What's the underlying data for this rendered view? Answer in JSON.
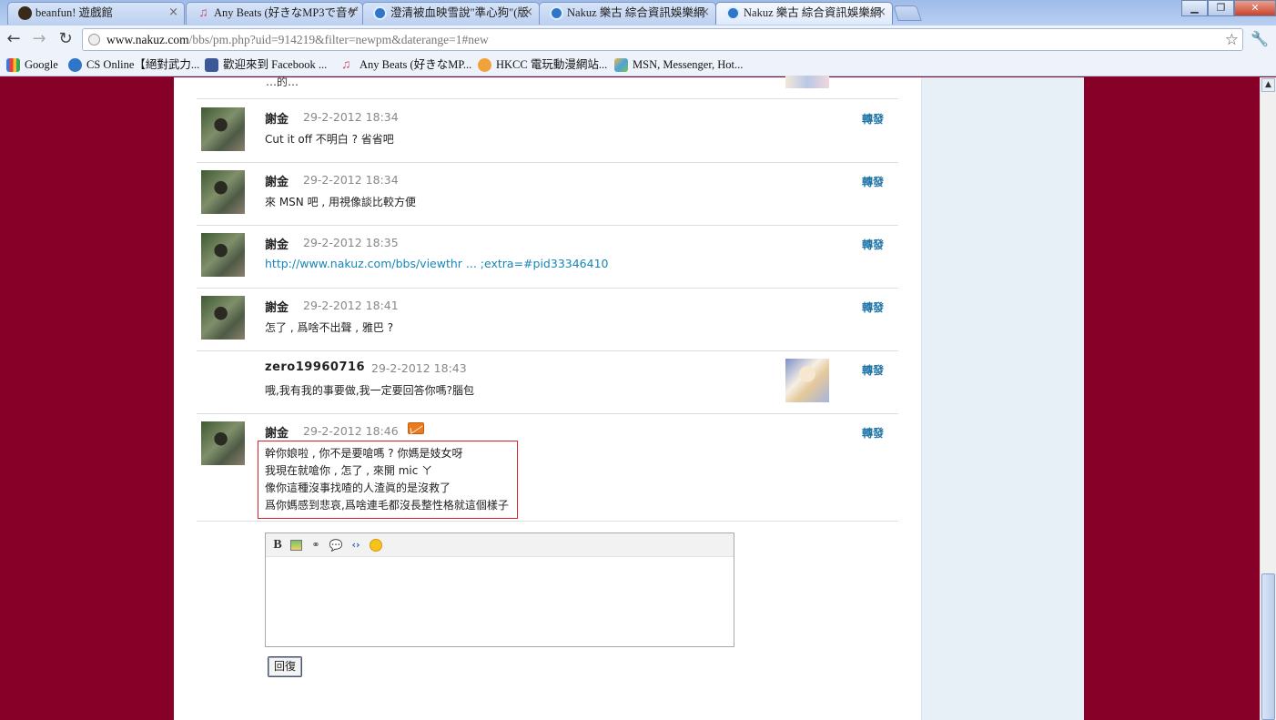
{
  "browser": {
    "tabs": [
      {
        "title": "beanfun! 遊戲館",
        "icon": "beanfun-icon"
      },
      {
        "title": "Any Beats (好きなMP3で音ゲ",
        "icon": "music-note-icon"
      },
      {
        "title": "澄清被血映雪說\"準心狗\"(版",
        "icon": "nakuz-icon"
      },
      {
        "title": "Nakuz 樂古 綜合資訊娛樂網",
        "icon": "nakuz-icon"
      },
      {
        "title": "Nakuz 樂古 綜合資訊娛樂網",
        "icon": "nakuz-icon"
      }
    ],
    "tab_close": "×",
    "url_host": "www.nakuz.com",
    "url_path": "/bbs/pm.php?uid=914219&filter=newpm&daterange=1#new",
    "bookmarks": [
      {
        "label": "Google",
        "icon": "google-icon"
      },
      {
        "label": "CS Online【絕對武力...",
        "icon": "nakuz-icon"
      },
      {
        "label": "歡迎來到 Facebook ...",
        "icon": "facebook-icon"
      },
      {
        "label": "Any Beats (好きなMP...",
        "icon": "music-note-icon"
      },
      {
        "label": "HKCC 電玩動漫網站...",
        "icon": "hkcc-icon"
      },
      {
        "label": "MSN, Messenger, Hot...",
        "icon": "msn-icon"
      }
    ],
    "colors": {
      "page_background": "#870028",
      "link": "#1786b8",
      "highlight_border": "#d8232a"
    }
  },
  "clipped_top_text": "…的…",
  "forward_label": "轉發",
  "messages": [
    {
      "author": "謝金",
      "date": "29-2-2012 18:34",
      "body": "Cut it off 不明白 ? 省省吧"
    },
    {
      "author": "謝金",
      "date": "29-2-2012 18:34",
      "body": "來 MSN 吧 , 用視像談比較方便"
    },
    {
      "author": "謝金",
      "date": "29-2-2012 18:35",
      "body": "http://www.nakuz.com/bbs/viewthr ... ;extra=#pid33346410"
    },
    {
      "author": "謝金",
      "date": "29-2-2012 18:41",
      "body": "怎了 , 爲啥不出聲 , 雅巴 ?"
    },
    {
      "author": "zero19960716",
      "date": "29-2-2012 18:43",
      "body": "哦,我有我的事要做,我一定要回答你嗎?腦包"
    },
    {
      "author": "謝金",
      "date": "29-2-2012 18:46",
      "lines": [
        "幹你娘啦 , 你不是要嗆嗎 ? 你媽是妓女呀",
        "我現在就嗆你 , 怎了 , 來開 mic ㄚ",
        "像你這種沒事找喳的人渣眞的是沒救了",
        "爲你媽感到悲哀,爲啥連毛都沒長整性格就這個樣子"
      ]
    }
  ],
  "editor": {
    "tools": [
      "bold-icon",
      "image-icon",
      "link-icon",
      "quote-icon",
      "code-icon",
      "smiley-icon"
    ],
    "bold_glyph": "B",
    "reply_label": "回復"
  }
}
